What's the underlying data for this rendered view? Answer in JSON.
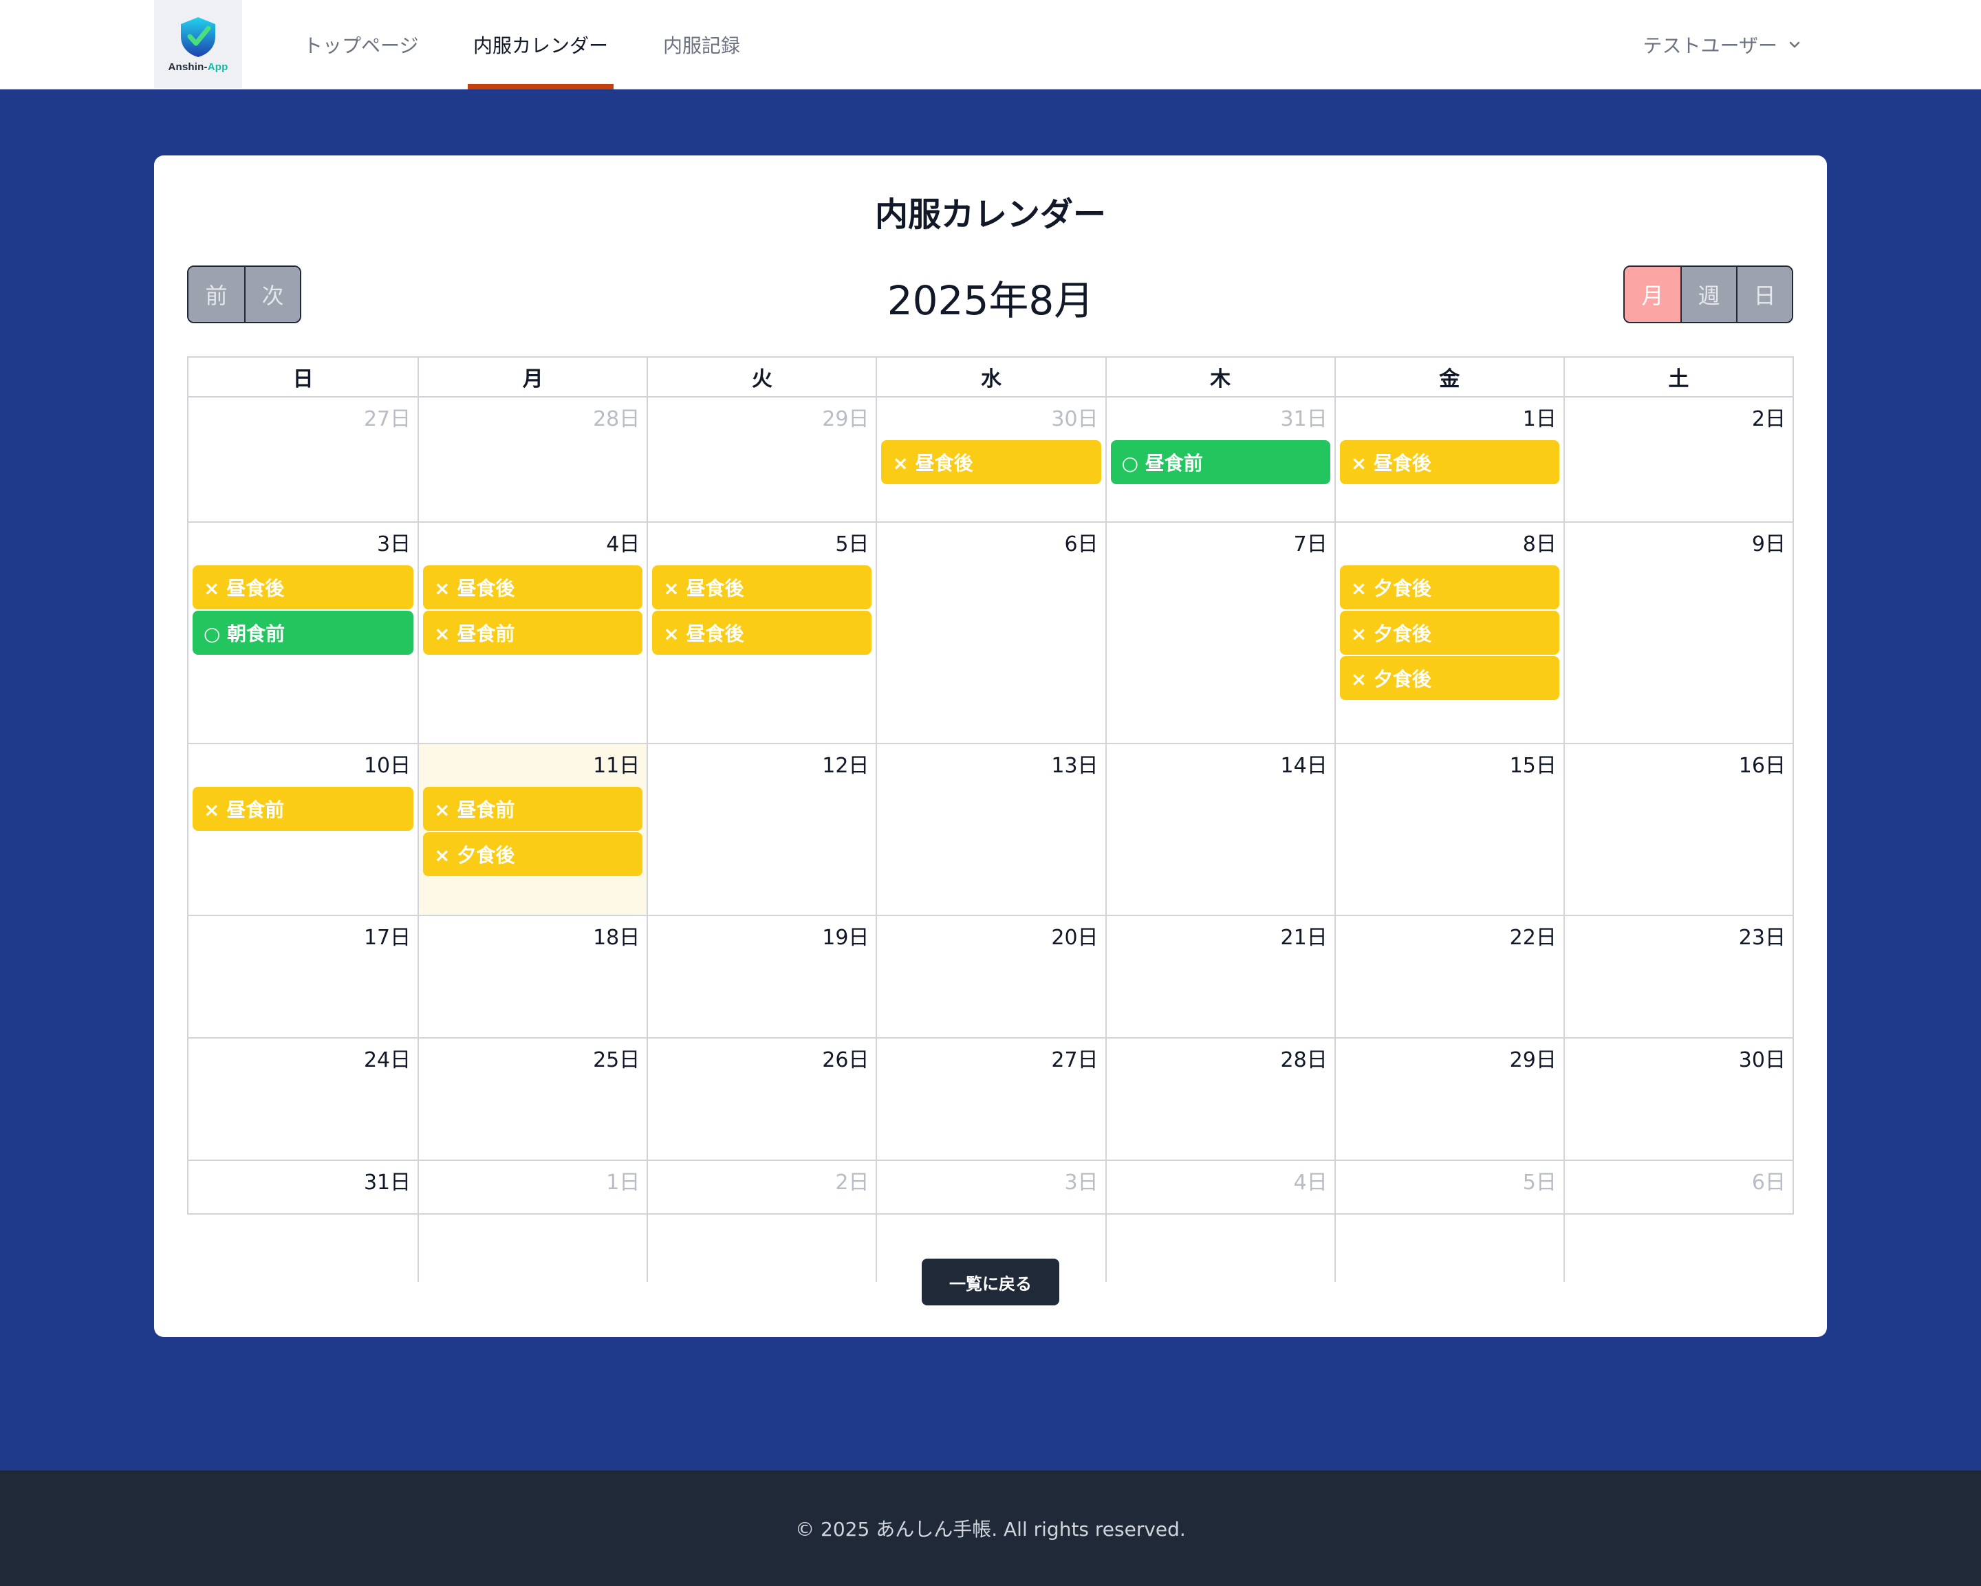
{
  "header": {
    "logo_text": "Anshin-",
    "logo_text_app": "App",
    "nav": [
      {
        "label": "トップページ",
        "active": false
      },
      {
        "label": "内服カレンダー",
        "active": true
      },
      {
        "label": "内服記録",
        "active": false
      }
    ],
    "user_name": "テストユーザー"
  },
  "page": {
    "title": "内服カレンダー",
    "month_title": "2025年8月",
    "nav_buttons": {
      "prev": "前",
      "next": "次"
    },
    "view_buttons": {
      "month": "月",
      "week": "週",
      "day": "日",
      "active": "月"
    },
    "back_button": "一覧に戻る"
  },
  "calendar": {
    "weekdays": [
      "日",
      "月",
      "火",
      "水",
      "木",
      "金",
      "土"
    ],
    "weeks": [
      [
        {
          "date": "27日",
          "other": true,
          "events": []
        },
        {
          "date": "28日",
          "other": true,
          "events": []
        },
        {
          "date": "29日",
          "other": true,
          "events": []
        },
        {
          "date": "30日",
          "other": true,
          "events": [
            {
              "label": "× 昼食後",
              "color": "yellow"
            }
          ]
        },
        {
          "date": "31日",
          "other": true,
          "events": [
            {
              "label": "○ 昼食前",
              "color": "green"
            }
          ]
        },
        {
          "date": "1日",
          "events": [
            {
              "label": "× 昼食後",
              "color": "yellow"
            }
          ]
        },
        {
          "date": "2日",
          "events": []
        }
      ],
      [
        {
          "date": "3日",
          "events": [
            {
              "label": "× 昼食後",
              "color": "yellow"
            },
            {
              "label": "○ 朝食前",
              "color": "green"
            }
          ]
        },
        {
          "date": "4日",
          "events": [
            {
              "label": "× 昼食後",
              "color": "yellow"
            },
            {
              "label": "× 昼食前",
              "color": "yellow"
            }
          ]
        },
        {
          "date": "5日",
          "events": [
            {
              "label": "× 昼食後",
              "color": "yellow"
            },
            {
              "label": "× 昼食後",
              "color": "yellow"
            }
          ]
        },
        {
          "date": "6日",
          "events": []
        },
        {
          "date": "7日",
          "events": []
        },
        {
          "date": "8日",
          "events": [
            {
              "label": "× 夕食後",
              "color": "yellow"
            },
            {
              "label": "× 夕食後",
              "color": "yellow"
            },
            {
              "label": "× 夕食後",
              "color": "yellow"
            }
          ]
        },
        {
          "date": "9日",
          "events": []
        }
      ],
      [
        {
          "date": "10日",
          "events": [
            {
              "label": "× 昼食前",
              "color": "yellow"
            }
          ]
        },
        {
          "date": "11日",
          "today": true,
          "events": [
            {
              "label": "× 昼食前",
              "color": "yellow"
            },
            {
              "label": "× 夕食後",
              "color": "yellow"
            }
          ]
        },
        {
          "date": "12日",
          "events": []
        },
        {
          "date": "13日",
          "events": []
        },
        {
          "date": "14日",
          "events": []
        },
        {
          "date": "15日",
          "events": []
        },
        {
          "date": "16日",
          "events": []
        }
      ],
      [
        {
          "date": "17日",
          "events": []
        },
        {
          "date": "18日",
          "events": []
        },
        {
          "date": "19日",
          "events": []
        },
        {
          "date": "20日",
          "events": []
        },
        {
          "date": "21日",
          "events": []
        },
        {
          "date": "22日",
          "events": []
        },
        {
          "date": "23日",
          "events": []
        }
      ],
      [
        {
          "date": "24日",
          "events": []
        },
        {
          "date": "25日",
          "events": []
        },
        {
          "date": "26日",
          "events": []
        },
        {
          "date": "27日",
          "events": []
        },
        {
          "date": "28日",
          "events": []
        },
        {
          "date": "29日",
          "events": []
        },
        {
          "date": "30日",
          "events": []
        }
      ],
      [
        {
          "date": "31日",
          "events": []
        },
        {
          "date": "1日",
          "other": true,
          "events": []
        },
        {
          "date": "2日",
          "other": true,
          "events": []
        },
        {
          "date": "3日",
          "other": true,
          "events": []
        },
        {
          "date": "4日",
          "other": true,
          "events": []
        },
        {
          "date": "5日",
          "other": true,
          "events": []
        },
        {
          "date": "6日",
          "other": true,
          "events": []
        }
      ]
    ]
  },
  "footer": {
    "copyright": "© 2025 あんしん手帳. All rights reserved."
  },
  "colors": {
    "background": "#1f3a8a",
    "event_yellow": "#facc15",
    "event_green": "#22c55e",
    "nav_active_underline": "#c2410c",
    "view_active": "#fca5a5",
    "footer": "#1f2937"
  },
  "icons": {
    "logo": "shield-check-icon",
    "user_menu": "chevron-down-icon"
  }
}
